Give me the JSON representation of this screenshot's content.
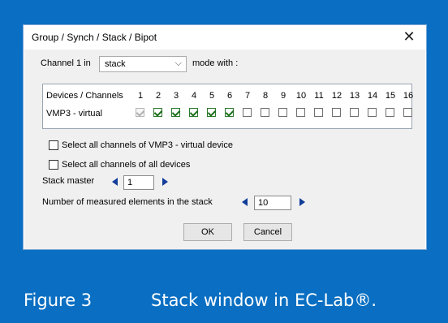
{
  "dialog": {
    "title": "Group / Synch / Stack / Bipot",
    "close_glyph": "✕",
    "channel_label": "Channel 1 in",
    "mode_select": {
      "value": "stack",
      "chevron": "⌵"
    },
    "mode_suffix": "mode with :",
    "grid": {
      "header_label": "Devices / Channels",
      "channels": [
        "1",
        "2",
        "3",
        "4",
        "5",
        "6",
        "7",
        "8",
        "9",
        "10",
        "11",
        "12",
        "13",
        "14",
        "15",
        "16"
      ],
      "device_name": "VMP3 - virtual",
      "channel_states": [
        "disabled-checked",
        "checked",
        "checked",
        "checked",
        "checked",
        "checked",
        "unchecked",
        "unchecked",
        "unchecked",
        "unchecked",
        "unchecked",
        "unchecked",
        "unchecked",
        "unchecked",
        "unchecked",
        "unchecked"
      ]
    },
    "select_all_device": "Select all channels of VMP3 - virtual device",
    "select_all_devices": "Select all channels of all devices",
    "stack_master_label": "Stack master",
    "stack_master_value": "1",
    "measured_label": "Number of measured elements in the stack",
    "measured_value": "10",
    "ok_label": "OK",
    "cancel_label": "Cancel"
  },
  "caption": {
    "figure": "Figure 3",
    "text": "Stack window in EC-Lab®."
  },
  "colors": {
    "background": "#0a6fc2",
    "arrow": "#123e9a",
    "check": "#1b6d1b"
  }
}
